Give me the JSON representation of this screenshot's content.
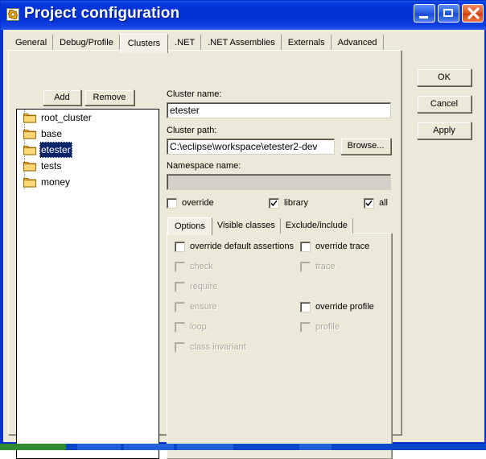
{
  "window": {
    "title": "Project configuration",
    "icon": "gear-icon",
    "accent_color": "#0431d4",
    "client_color": "#ece9d8",
    "controls": {
      "minimize": "minimize-icon",
      "maximize": "maximize-icon",
      "close": "close-icon"
    }
  },
  "tabs": [
    {
      "label": "General",
      "selected": false
    },
    {
      "label": "Debug/Profile",
      "selected": false
    },
    {
      "label": "Clusters",
      "selected": true
    },
    {
      "label": ".NET",
      "selected": false
    },
    {
      "label": ".NET Assemblies",
      "selected": false
    },
    {
      "label": "Externals",
      "selected": false
    },
    {
      "label": "Advanced",
      "selected": false
    }
  ],
  "dialog_buttons": {
    "ok": "OK",
    "cancel": "Cancel",
    "apply": "Apply"
  },
  "clusters_panel": {
    "add_label": "Add",
    "remove_label": "Remove",
    "tree": [
      {
        "label": "root_cluster",
        "selected": false,
        "icon": "folder-icon"
      },
      {
        "label": "base",
        "selected": false,
        "icon": "folder-icon"
      },
      {
        "label": "etester",
        "selected": true,
        "icon": "folder-icon"
      },
      {
        "label": "tests",
        "selected": false,
        "icon": "folder-icon"
      },
      {
        "label": "money",
        "selected": false,
        "icon": "folder-icon"
      }
    ],
    "fields": {
      "cluster_name_label": "Cluster name:",
      "cluster_name_value": "etester",
      "cluster_name_placeholder": "",
      "cluster_path_label": "Cluster path:",
      "cluster_path_value": "C:\\eclipse\\workspace\\etester2-dev",
      "cluster_path_placeholder": "",
      "browse_label": "Browse...",
      "namespace_label": "Namespace name:",
      "namespace_value": "",
      "namespace_placeholder": "",
      "namespace_disabled": true
    },
    "toggles": [
      {
        "label": "override",
        "checked": false,
        "disabled": false
      },
      {
        "label": "library",
        "checked": true,
        "disabled": false
      },
      {
        "label": "all",
        "checked": true,
        "disabled": false
      }
    ],
    "inner_tabs": [
      {
        "label": "Options",
        "selected": true
      },
      {
        "label": "Visible classes",
        "selected": false
      },
      {
        "label": "Exclude/include",
        "selected": false
      }
    ],
    "options_left": [
      {
        "label": "override default assertions",
        "checked": false,
        "disabled": false
      },
      {
        "label": "check",
        "checked": false,
        "disabled": true
      },
      {
        "label": "require",
        "checked": false,
        "disabled": true
      },
      {
        "label": "ensure",
        "checked": false,
        "disabled": true
      },
      {
        "label": "loop",
        "checked": false,
        "disabled": true
      },
      {
        "label": "class invariant",
        "checked": false,
        "disabled": true
      }
    ],
    "options_right": [
      {
        "label": "override trace",
        "checked": false,
        "disabled": false,
        "row": 0
      },
      {
        "label": "trace",
        "checked": false,
        "disabled": true,
        "row": 1
      },
      {
        "label": "override profile",
        "checked": false,
        "disabled": false,
        "row": 3
      },
      {
        "label": "profile",
        "checked": false,
        "disabled": true,
        "row": 4
      }
    ]
  }
}
